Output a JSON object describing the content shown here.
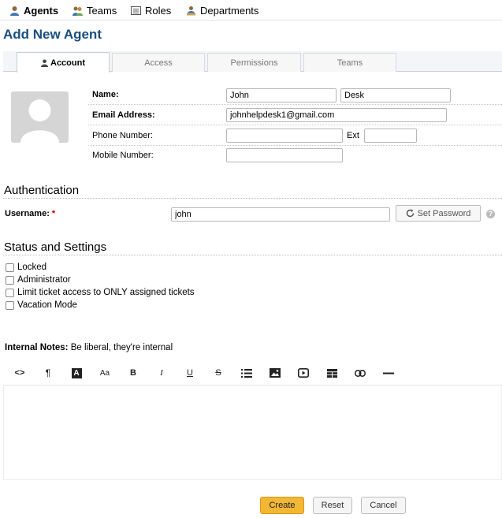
{
  "nav": {
    "items": [
      {
        "label": "Agents",
        "icon": "agent-icon",
        "active": true
      },
      {
        "label": "Teams",
        "icon": "teams-icon",
        "active": false
      },
      {
        "label": "Roles",
        "icon": "roles-icon",
        "active": false
      },
      {
        "label": "Departments",
        "icon": "departments-icon",
        "active": false
      }
    ]
  },
  "page_title": "Add New Agent",
  "tabs": [
    {
      "label": "Account",
      "active": true,
      "icon": "user-icon"
    },
    {
      "label": "Access",
      "active": false
    },
    {
      "label": "Permissions",
      "active": false
    },
    {
      "label": "Teams",
      "active": false
    }
  ],
  "account": {
    "name_label": "Name:",
    "first_name": "John",
    "last_name": "Desk",
    "email_label": "Email Address:",
    "email": "johnhelpdesk1@gmail.com",
    "phone_label": "Phone Number:",
    "phone": "",
    "ext_label": "Ext",
    "ext": "",
    "mobile_label": "Mobile Number:",
    "mobile": ""
  },
  "authentication": {
    "heading": "Authentication",
    "username_label": "Username:",
    "required_mark": "*",
    "username": "john",
    "set_password_label": "Set Password",
    "help_icon": "question-circle-icon",
    "help_glyph": "?"
  },
  "status": {
    "heading": "Status and Settings",
    "options": [
      {
        "label": "Locked",
        "checked": false
      },
      {
        "label": "Administrator",
        "checked": false
      },
      {
        "label": "Limit ticket access to ONLY assigned tickets",
        "checked": false
      },
      {
        "label": "Vacation Mode",
        "checked": false
      }
    ]
  },
  "notes": {
    "label": "Internal Notes:",
    "hint": "Be liberal, they're internal",
    "toolbar": [
      {
        "name": "code-view-icon",
        "glyph": "<>"
      },
      {
        "name": "paragraph-format-icon",
        "glyph": "¶"
      },
      {
        "name": "text-color-icon",
        "glyph": "A"
      },
      {
        "name": "font-size-icon",
        "glyph": "Aa"
      },
      {
        "name": "bold-icon",
        "glyph": "B"
      },
      {
        "name": "italic-icon",
        "glyph": "I"
      },
      {
        "name": "underline-icon",
        "glyph": "U"
      },
      {
        "name": "strikethrough-icon",
        "glyph": "S"
      },
      {
        "name": "list-icon",
        "glyph": "≡"
      },
      {
        "name": "image-icon",
        "glyph": "▣"
      },
      {
        "name": "video-icon",
        "glyph": "▶"
      },
      {
        "name": "table-icon",
        "glyph": "▦"
      },
      {
        "name": "link-icon",
        "glyph": "⊂⊃"
      },
      {
        "name": "horizontal-rule-icon",
        "glyph": "—"
      }
    ]
  },
  "footer": {
    "create_label": "Create",
    "reset_label": "Reset",
    "cancel_label": "Cancel"
  },
  "colors": {
    "title": "#184e81",
    "primary_button": "#f3b736",
    "required": "#cc0000"
  }
}
